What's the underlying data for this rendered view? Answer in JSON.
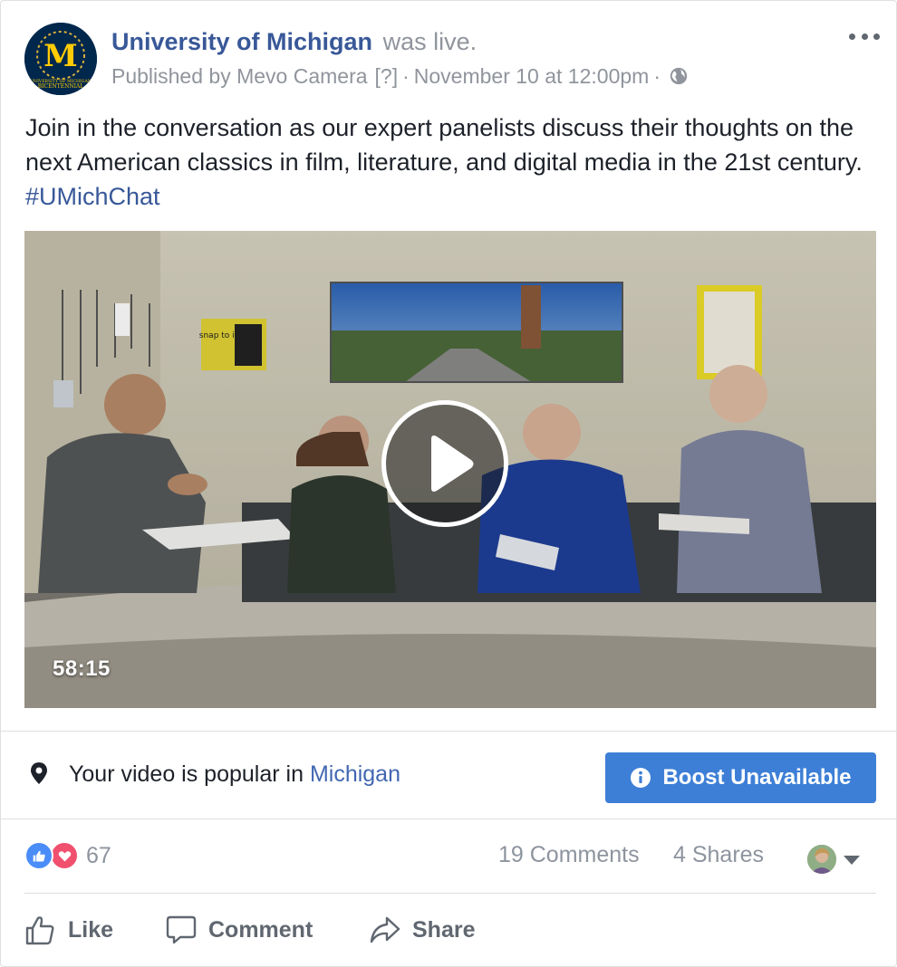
{
  "post": {
    "author": "University of Michigan",
    "author_suffix": "was live.",
    "published_by": "Published by Mevo Camera",
    "help_marker": "[?]",
    "separator": "·",
    "timestamp": "November 10 at 12:00pm",
    "privacy_icon": "globe-icon",
    "text_main": "Join in the conversation as our expert panelists discuss their thoughts on the next American classics in film, literature, and digital media in the 21st century.",
    "hashtag": "#UMichChat",
    "avatar_letter": "M",
    "avatar_caption_1": "UNIVERSITY OF MICHIGAN",
    "avatar_caption_2": "BICENTENNIAL"
  },
  "video": {
    "duration": "58:15",
    "play_icon": "play-icon",
    "wall_sign_text": "snap to it"
  },
  "insight": {
    "text": "Your video is popular in",
    "location": "Michigan",
    "icon": "location-pin-icon",
    "boost_label": "Boost Unavailable",
    "boost_icon": "info-icon",
    "boost_color": "#3d7fd6"
  },
  "stats": {
    "reaction_count": "67",
    "comments": "19 Comments",
    "shares": "4 Shares",
    "reaction_icons": [
      "like-icon",
      "love-icon"
    ]
  },
  "actions": {
    "like": "Like",
    "comment": "Comment",
    "share": "Share"
  },
  "colors": {
    "link": "#385898",
    "muted": "#90949c",
    "text": "#1d2129"
  }
}
